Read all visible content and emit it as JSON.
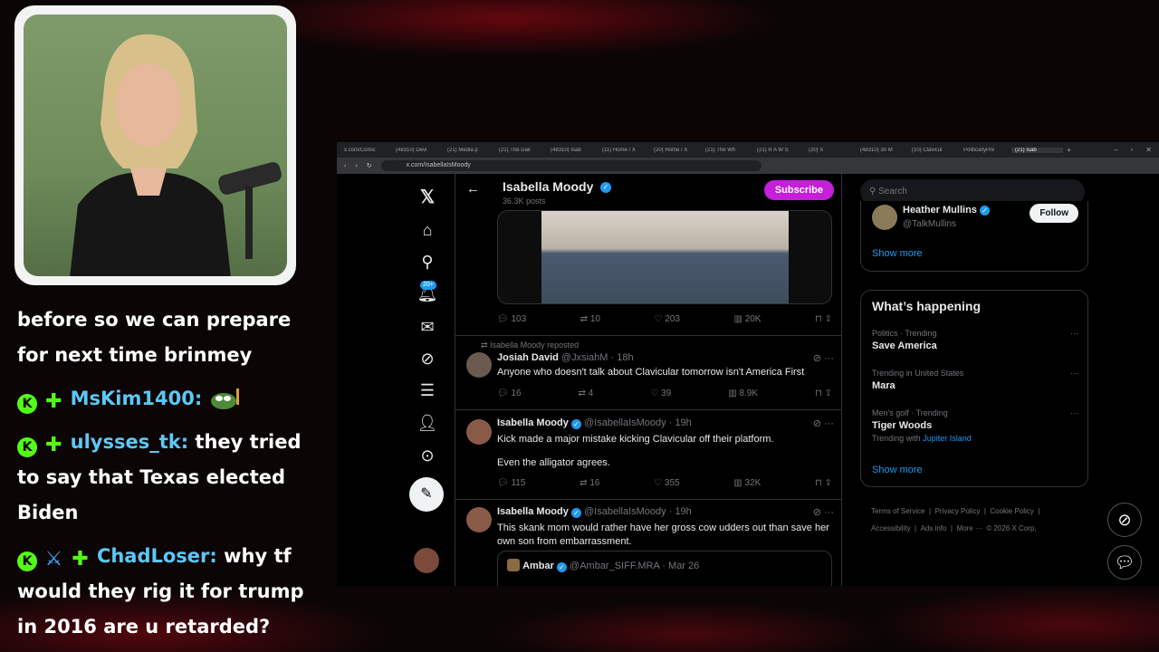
{
  "chat": [
    {
      "user": "",
      "user_color": "#ffffff",
      "text": "before so we can prepare for next time brinmey",
      "badges": []
    },
    {
      "user": "MsKim1400:",
      "user_color": "#5bc8f5",
      "text": "",
      "badges": [
        "k",
        "plus"
      ]
    },
    {
      "user": "ulysses_tk:",
      "user_color": "#5bc8f5",
      "text": "they tried to say that Texas elected Biden",
      "badges": [
        "k",
        "plus"
      ]
    },
    {
      "user": "ChadLoser:",
      "user_color": "#5bc8f5",
      "text": "why tf would they rig it for trump in 2016 are u retarded?",
      "badges": [
        "k",
        "sword",
        "plus"
      ]
    }
  ],
  "browser": {
    "tabs": [
      "x.com/Comic",
      "(48310) Devi",
      "(21) Media p",
      "(21) The Dail",
      "(48310) Isab",
      "(11) Home / X",
      "(20) Home / X",
      "(21) The Wh",
      "(21) R A W S",
      "(20) X",
      "(48310) 30 M",
      "(10) Clavicul",
      "PoliticallyPre",
      "(21) Isab"
    ],
    "url": "x.com/IsabellaIsMoody"
  },
  "profile": {
    "name": "Isabella Moody",
    "posts": "36.3K posts",
    "subscribe": "Subscribe"
  },
  "tweets": [
    {
      "id": "media",
      "replies": "103",
      "reposts": "10",
      "likes": "203",
      "views": "20K"
    },
    {
      "id": "t1",
      "repost_note": "Isabella Moody reposted",
      "name": "Josiah David",
      "handle": "@JxsiahM",
      "time": "18h",
      "text": "Anyone who doesn't talk about Clavicular tomorrow isn't America First",
      "replies": "16",
      "reposts": "4",
      "likes": "39",
      "views": "8.9K"
    },
    {
      "id": "t2",
      "name": "Isabella Moody",
      "handle": "@IsabellaIsMoody",
      "time": "19h",
      "text": "Kick made a major mistake kicking Clavicular off their platform.",
      "text2": "Even the alligator agrees.",
      "replies": "115",
      "reposts": "16",
      "likes": "355",
      "views": "32K"
    },
    {
      "id": "t3",
      "name": "Isabella Moody",
      "handle": "@IsabellaIsMoody",
      "time": "19h",
      "text": "This skank mom would rather have her gross cow udders out than save her own son from embarrassment.",
      "quote_name": "Ambar",
      "quote_handle": "@Ambar_SIFF.MRA",
      "quote_time": "Mar 26"
    }
  ],
  "sidebar": {
    "search_placeholder": "Search",
    "follow_card": {
      "name": "Heather Mullins",
      "handle": "@TalkMullins",
      "follow": "Follow",
      "show_more": "Show more"
    },
    "happening_title": "What’s happening",
    "trends": [
      {
        "category": "Politics · Trending",
        "name": "Save America"
      },
      {
        "category": "Trending in United States",
        "name": "Mara"
      },
      {
        "category": "Men's golf · Trending",
        "name": "Tiger Woods",
        "with_label": "Trending with",
        "with_link": "Jupiter Island"
      }
    ],
    "show_more": "Show more",
    "footer": [
      "Terms of Service",
      "Privacy Policy",
      "Cookie Policy",
      "Accessibility",
      "Ads info",
      "More ···",
      "© 2026 X Corp."
    ]
  },
  "nav": {
    "notification_badge": "20+"
  },
  "colors": {
    "accent": "#1d9bf0",
    "subscribe": "#c51fd9",
    "kick_green": "#53fc18"
  }
}
